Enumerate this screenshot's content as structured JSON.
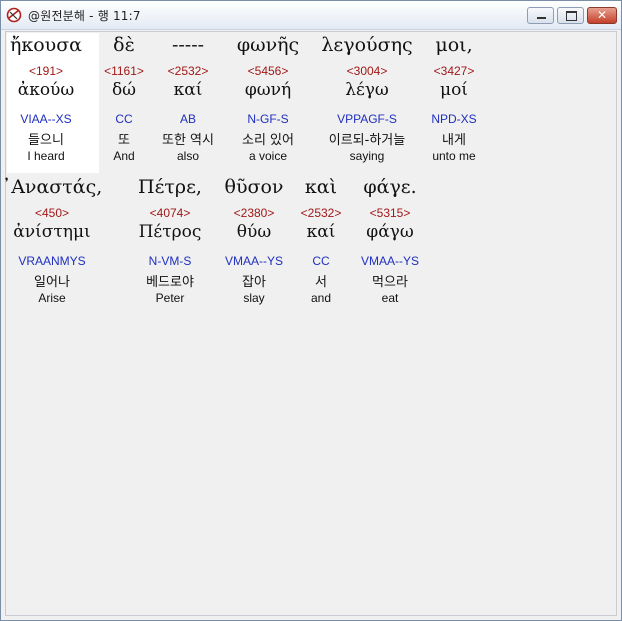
{
  "window": {
    "title": "@원전분해 - 행 11:7",
    "buttons": {
      "minimize": "minimize",
      "maximize": "maximize",
      "close": "✕"
    }
  },
  "lines": [
    {
      "words": [
        {
          "greek": "ἤκουσα",
          "strong": "<191>",
          "lemma": "ἀκούω",
          "morph": "VIAA--XS",
          "korean": "들으니",
          "english": "I heard",
          "selected": true
        },
        {
          "greek": "δὲ",
          "strong": "<1161>",
          "lemma": "δώ",
          "morph": "CC",
          "korean": "또",
          "english": "And"
        },
        {
          "greek": "-----",
          "strong": "<2532>",
          "lemma": "καί",
          "morph": "AB",
          "korean": "또한 역시",
          "english": "also"
        },
        {
          "greek": "φωνῆς",
          "strong": "<5456>",
          "lemma": "φωνή",
          "morph": "N-GF-S",
          "korean": "소리 있어",
          "english": "a voice"
        },
        {
          "greek": "λεγούσης",
          "strong": "<3004>",
          "lemma": "λέγω",
          "morph": "VPPAGF-S",
          "korean": "이르되-하거늘",
          "english": "saying"
        },
        {
          "greek": "μοι,",
          "strong": "<3427>",
          "lemma": "μοί",
          "morph": "NPD-XS",
          "korean": "내게",
          "english": "unto me"
        }
      ]
    },
    {
      "words": [
        {
          "greek": "᾿Αναστάς,",
          "strong": "<450>",
          "lemma": "ἀνίστημι",
          "morph": "VRAANMYS",
          "korean": "일어나",
          "english": "Arise"
        },
        {
          "greek": "Πέτρε,",
          "strong": "<4074>",
          "lemma": "Πέτρος",
          "morph": "N-VM-S",
          "korean": "베드로야",
          "english": "Peter"
        },
        {
          "greek": "θῦσον",
          "strong": "<2380>",
          "lemma": "θύω",
          "morph": "VMAA--YS",
          "korean": "잡아",
          "english": "slay"
        },
        {
          "greek": "καὶ",
          "strong": "<2532>",
          "lemma": "καί",
          "morph": "CC",
          "korean": "서",
          "english": "and"
        },
        {
          "greek": "φάγε.",
          "strong": "<5315>",
          "lemma": "φάγω",
          "morph": "VMAA--YS",
          "korean": "먹으라",
          "english": "eat"
        }
      ]
    }
  ]
}
